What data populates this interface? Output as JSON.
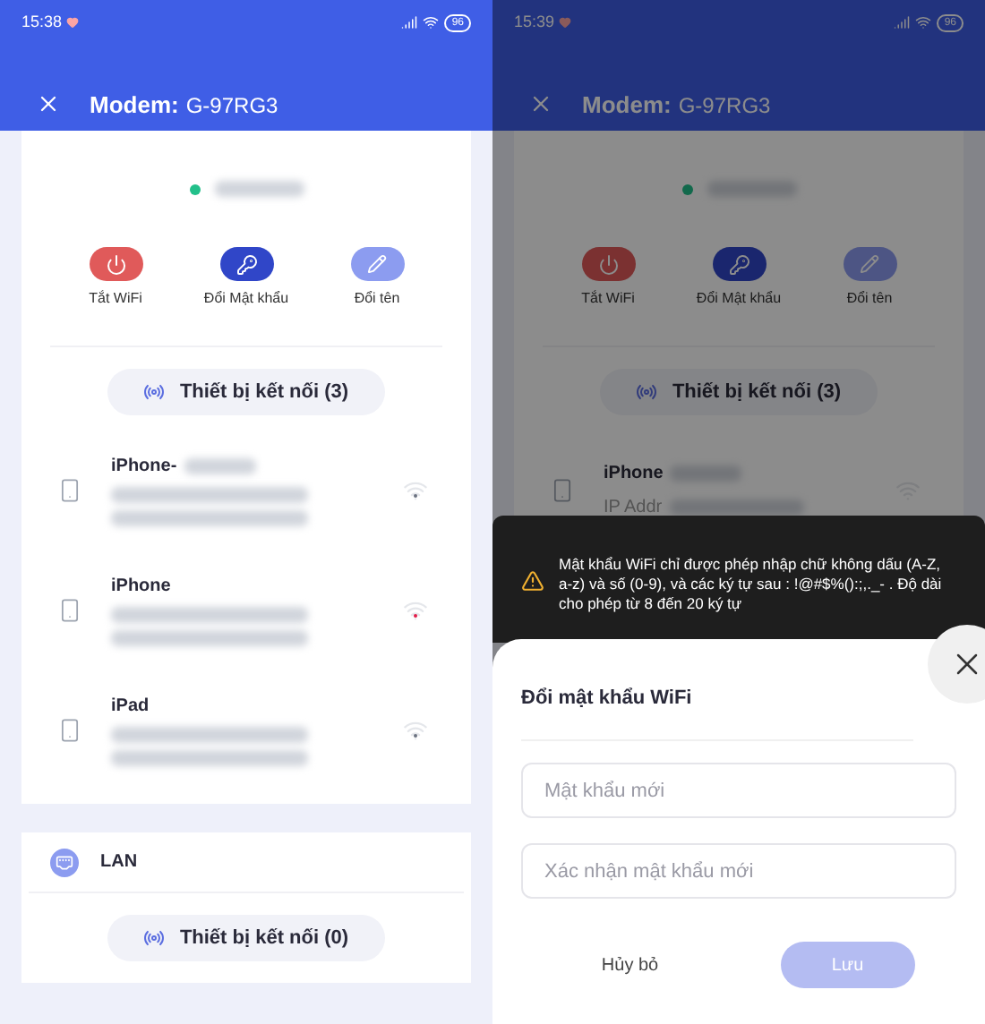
{
  "screens": [
    {
      "dimmed": false,
      "status_bar": {
        "time": "15:38",
        "battery": "96"
      },
      "header": {
        "title": "Modem:",
        "model": "G-97RG3"
      },
      "actions": [
        {
          "kind": "power",
          "label": "Tắt WiFi"
        },
        {
          "kind": "key",
          "label": "Đổi Mật khẩu"
        },
        {
          "kind": "rename",
          "label": "Đổi tên"
        }
      ],
      "connected_button": "Thiết bị kết nối (3)",
      "devices": [
        {
          "name": "iPhone-",
          "color": "#6b7280"
        },
        {
          "name": "iPhone",
          "color": "#e11d48"
        },
        {
          "name": "iPad",
          "color": "#6b7280"
        }
      ],
      "lan": {
        "title": "LAN",
        "connected_button": "Thiết bị kết nối (0)"
      }
    },
    {
      "dimmed": true,
      "status_bar": {
        "time": "15:39",
        "battery": "96"
      },
      "header": {
        "title": "Modem:",
        "model": "G-97RG3"
      },
      "actions": [
        {
          "kind": "power",
          "label": "Tắt WiFi"
        },
        {
          "kind": "key",
          "label": "Đổi Mật khẩu"
        },
        {
          "kind": "rename",
          "label": "Đổi tên"
        }
      ],
      "connected_button": "Thiết bị kết nối (3)",
      "devices": [
        {
          "name": "iPhone",
          "detail": "IP Addr"
        }
      ]
    }
  ],
  "toast": {
    "text": "Mật khẩu WiFi chỉ được phép nhập chữ không dấu (A-Z, a-z) và số (0-9), và các ký tự sau : !@#$%():;,._- . Độ dài cho phép từ 8 đến 20 ký tự"
  },
  "dialog": {
    "title": "Đổi mật khẩu WiFi",
    "fields": [
      {
        "placeholder": "Mật khẩu mới"
      },
      {
        "placeholder": "Xác nhận mật khẩu mới"
      }
    ],
    "cancel": "Hủy bỏ",
    "save": "Lưu",
    "save_disabled": true
  }
}
